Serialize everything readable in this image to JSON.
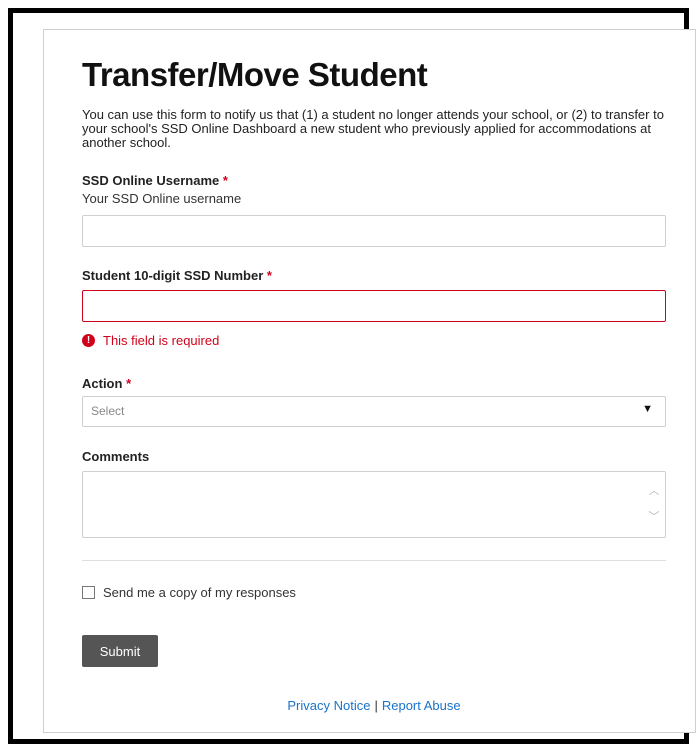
{
  "form": {
    "title": "Transfer/Move Student",
    "intro": "You can use this form to notify us that (1) a student no longer attends your school, or (2) to transfer to your school's SSD Online Dashboard a new student who previously applied for accommodations at another school.",
    "required_marker": "*",
    "username": {
      "label": "SSD Online Username",
      "help": "Your SSD Online username",
      "value": ""
    },
    "ssd_number": {
      "label": "Student 10-digit SSD Number",
      "value": "",
      "error": "This field is required"
    },
    "action": {
      "label": "Action",
      "selected": "Select"
    },
    "comments": {
      "label": "Comments",
      "value": ""
    },
    "copy_checkbox": {
      "label": "Send me a copy of my responses",
      "checked": false
    },
    "submit_label": "Submit"
  },
  "footer": {
    "privacy": "Privacy Notice",
    "separator": "|",
    "report": "Report Abuse"
  },
  "colors": {
    "error": "#d0021b",
    "link": "#1a73c8",
    "button": "#555555"
  }
}
